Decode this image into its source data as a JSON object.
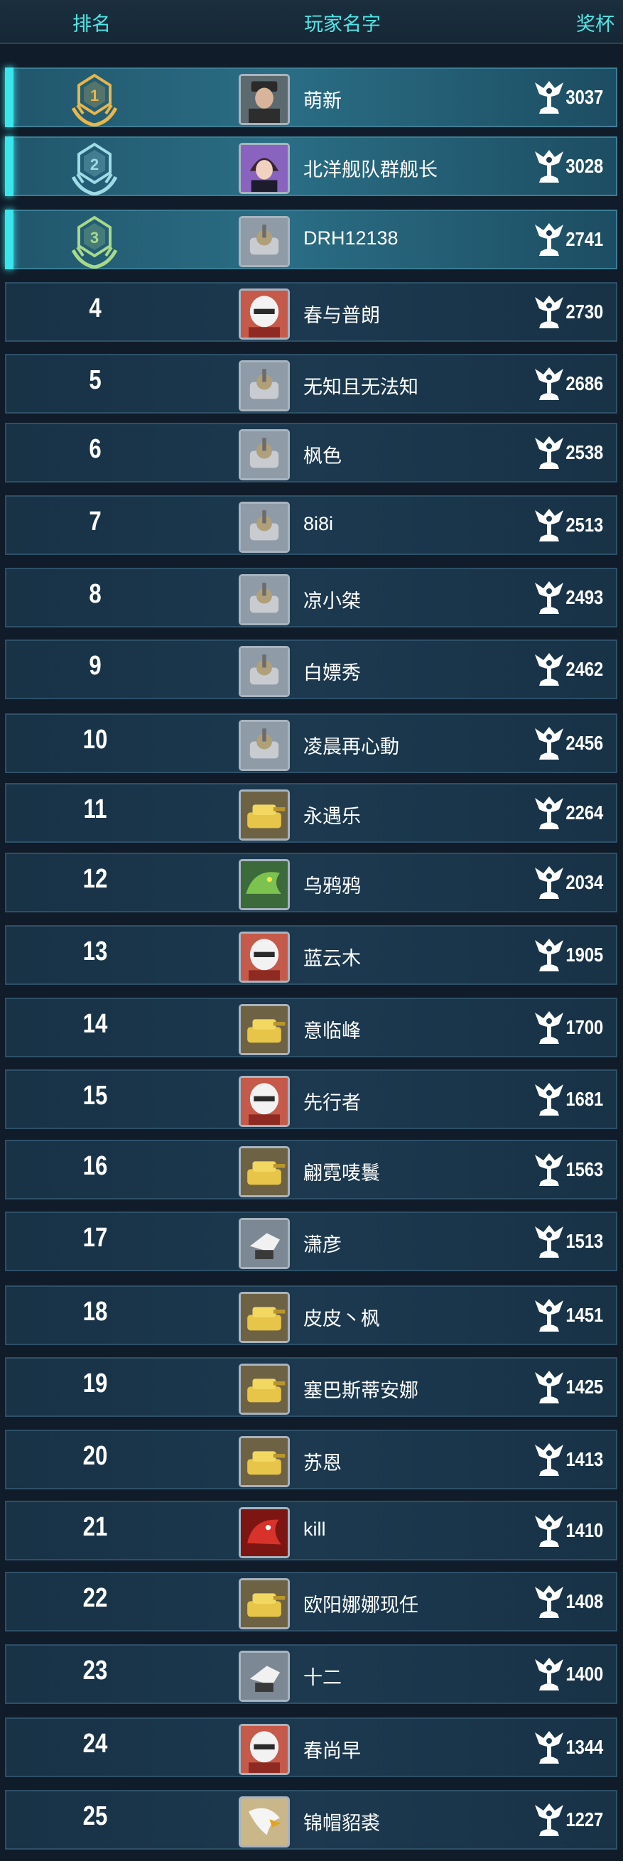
{
  "header": {
    "rank": "排名",
    "name": "玩家名字",
    "trophy": "奖杯"
  },
  "colors": {
    "accent": "#3ae6ec",
    "header_text": "#52e6e6",
    "gold": "#e8b64a",
    "silver": "#9fdbe6",
    "bronze": "#a8d98a"
  },
  "rows": [
    {
      "rank": "1",
      "name": "萌新",
      "trophies": "3037",
      "medal": "gold-medal",
      "avatar": "officer-portrait"
    },
    {
      "rank": "2",
      "name": "北洋舰队群舰长",
      "trophies": "3028",
      "medal": "silver-medal",
      "avatar": "anime-portrait"
    },
    {
      "rank": "3",
      "name": "DRH12138",
      "trophies": "2741",
      "medal": "bronze-medal",
      "avatar": "silver-tank"
    },
    {
      "rank": "4",
      "name": "春与普朗",
      "trophies": "2730",
      "avatar": "white-helmet"
    },
    {
      "rank": "5",
      "name": "无知且无法知",
      "trophies": "2686",
      "avatar": "silver-tank"
    },
    {
      "rank": "6",
      "name": "枫色",
      "trophies": "2538",
      "avatar": "silver-tank"
    },
    {
      "rank": "7",
      "name": "8i8i",
      "trophies": "2513",
      "avatar": "silver-tank"
    },
    {
      "rank": "8",
      "name": "凉小桀",
      "trophies": "2493",
      "avatar": "silver-tank"
    },
    {
      "rank": "9",
      "name": "白嫖秀",
      "trophies": "2462",
      "avatar": "silver-tank"
    },
    {
      "rank": "10",
      "name": "凌晨再心動",
      "trophies": "2456",
      "avatar": "silver-tank"
    },
    {
      "rank": "11",
      "name": "永遇乐",
      "trophies": "2264",
      "avatar": "gold-tank"
    },
    {
      "rank": "12",
      "name": "乌鸦鸦",
      "trophies": "2034",
      "avatar": "green-dragon"
    },
    {
      "rank": "13",
      "name": "蓝云木",
      "trophies": "1905",
      "avatar": "white-helmet"
    },
    {
      "rank": "14",
      "name": "意临峰",
      "trophies": "1700",
      "avatar": "gold-tank"
    },
    {
      "rank": "15",
      "name": "先行者",
      "trophies": "1681",
      "avatar": "white-helmet"
    },
    {
      "rank": "16",
      "name": "翩霓唛鬟",
      "trophies": "1563",
      "avatar": "gold-tank"
    },
    {
      "rank": "17",
      "name": "潇彦",
      "trophies": "1513",
      "avatar": "white-robot"
    },
    {
      "rank": "18",
      "name": "皮皮丶枫",
      "trophies": "1451",
      "avatar": "gold-tank"
    },
    {
      "rank": "19",
      "name": "塞巴斯蒂安娜",
      "trophies": "1425",
      "avatar": "gold-tank"
    },
    {
      "rank": "20",
      "name": "苏恩",
      "trophies": "1413",
      "avatar": "gold-tank"
    },
    {
      "rank": "21",
      "name": "kill",
      "trophies": "1410",
      "avatar": "red-dragon"
    },
    {
      "rank": "22",
      "name": "欧阳娜娜现任",
      "trophies": "1408",
      "avatar": "gold-tank"
    },
    {
      "rank": "23",
      "name": "十二",
      "trophies": "1400",
      "avatar": "white-robot"
    },
    {
      "rank": "24",
      "name": "春尚早",
      "trophies": "1344",
      "avatar": "white-helmet"
    },
    {
      "rank": "25",
      "name": "锦帽貂裘",
      "trophies": "1227",
      "avatar": "eagle"
    }
  ]
}
